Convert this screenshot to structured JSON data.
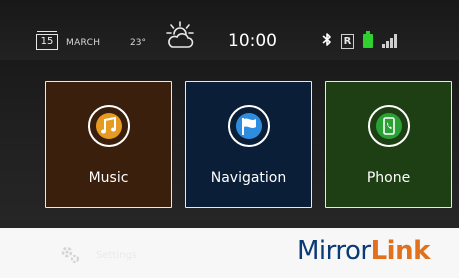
{
  "status_bar": {
    "date_day": "15",
    "month": "MARCH",
    "temperature": "23°",
    "weather_icon": "cloudy-sun-icon",
    "time": "10:00",
    "bluetooth_icon": "bluetooth-icon",
    "roaming_indicator": "R",
    "battery_icon": "battery-icon",
    "signal_icon": "signal-icon"
  },
  "apps": [
    {
      "label": "Music",
      "icon": "music-note-icon",
      "color": "#3a1f0c",
      "accent": "#e59a22"
    },
    {
      "label": "Navigation",
      "icon": "flag-icon",
      "color": "#0b1e38",
      "accent": "#2f8de0"
    },
    {
      "label": "Phone",
      "icon": "phone-icon",
      "color": "#1d3f13",
      "accent": "#2aa035"
    }
  ],
  "bottom_bar": {
    "settings_label": "Settings",
    "settings_icon": "gear-icon",
    "logo_part1": "Mirror",
    "logo_part2": "Link"
  }
}
